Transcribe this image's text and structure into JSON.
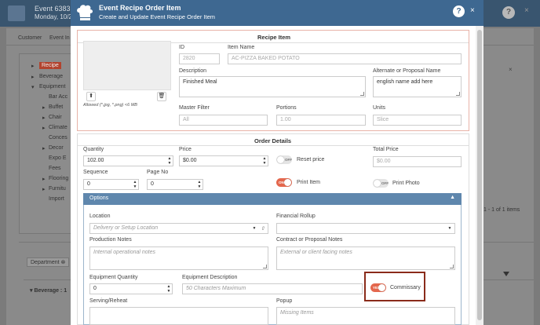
{
  "background": {
    "title": "Event 6383",
    "subtitle": "Monday, 10/2",
    "help": "?",
    "close": "×",
    "tabs": [
      "Customer",
      "Event In"
    ],
    "tree": [
      {
        "label": "Recipe",
        "selected": true
      },
      {
        "label": "Beverage"
      },
      {
        "label": "Equipment"
      },
      {
        "label": "Bar Acc"
      },
      {
        "label": "Buffet"
      },
      {
        "label": "Chair"
      },
      {
        "label": "Climate"
      },
      {
        "label": "Conces"
      },
      {
        "label": "Decor"
      },
      {
        "label": "Expo E"
      },
      {
        "label": "Fees"
      },
      {
        "label": "Flooring"
      },
      {
        "label": "Furnitu"
      },
      {
        "label": "Import"
      }
    ],
    "right_close": "×",
    "items_count": "1 - 1 of 1 items",
    "department_chip": "Department",
    "beverage_group": "Beverage : 1"
  },
  "modal": {
    "title": "Event Recipe Order Item",
    "subtitle": "Create and Update Event Recipe Order Item",
    "help": "?",
    "close": "×",
    "recipe_item": {
      "section_title": "Recipe Item",
      "image_note": "Allowed (*.jpg, *.png) <6 MB",
      "id_label": "ID",
      "id_value": "2820",
      "item_name_label": "Item Name",
      "item_name_value": "AC-PIZZA BAKED POTATO",
      "description_label": "Description",
      "description_value": "Finished Meal",
      "alt_name_label": "Alternate or Proposal Name",
      "alt_name_value": "english name add here",
      "master_filter_label": "Master Filter",
      "master_filter_value": "All",
      "portions_label": "Portions",
      "portions_value": "1.00",
      "units_label": "Units",
      "units_value": "Slice"
    },
    "order_details": {
      "section_title": "Order Details",
      "quantity_label": "Quantity",
      "quantity_value": "102.00",
      "price_label": "Price",
      "price_value": "$0.00",
      "reset_price_label": "Reset price",
      "reset_price_state": "OFF",
      "total_price_label": "Total Price",
      "total_price_value": "$0.00",
      "sequence_label": "Sequence",
      "sequence_value": "0",
      "page_no_label": "Page No",
      "page_no_value": "0",
      "print_item_label": "Print Item",
      "print_item_state": "ON",
      "print_photo_label": "Print Photo",
      "print_photo_state": "OFF"
    },
    "options": {
      "title": "Options",
      "location_label": "Location",
      "location_placeholder": "Delivery or Setup Location",
      "financial_rollup_label": "Financial Rollup",
      "production_notes_label": "Production Notes",
      "production_notes_placeholder": "Internal operational notes",
      "contract_notes_label": "Contract or Proposal Notes",
      "contract_notes_placeholder": "External or client facing notes",
      "equipment_qty_label": "Equipment Quantity",
      "equipment_qty_value": "0",
      "equipment_desc_label": "Equipment Description",
      "equipment_desc_placeholder": "50 Characters Maximum",
      "commissary_label": "Commissary",
      "commissary_state": "YES",
      "serving_label": "Serving/Reheat",
      "popup_label": "Popup",
      "popup_placeholder": "Missing Items"
    }
  },
  "colors": {
    "modal_header": "#3e6891",
    "options_bar": "#5f87ad",
    "toggle_on": "#e4674d",
    "highlight_border": "#8a2b1a",
    "selected_tree": "#b2432e"
  }
}
